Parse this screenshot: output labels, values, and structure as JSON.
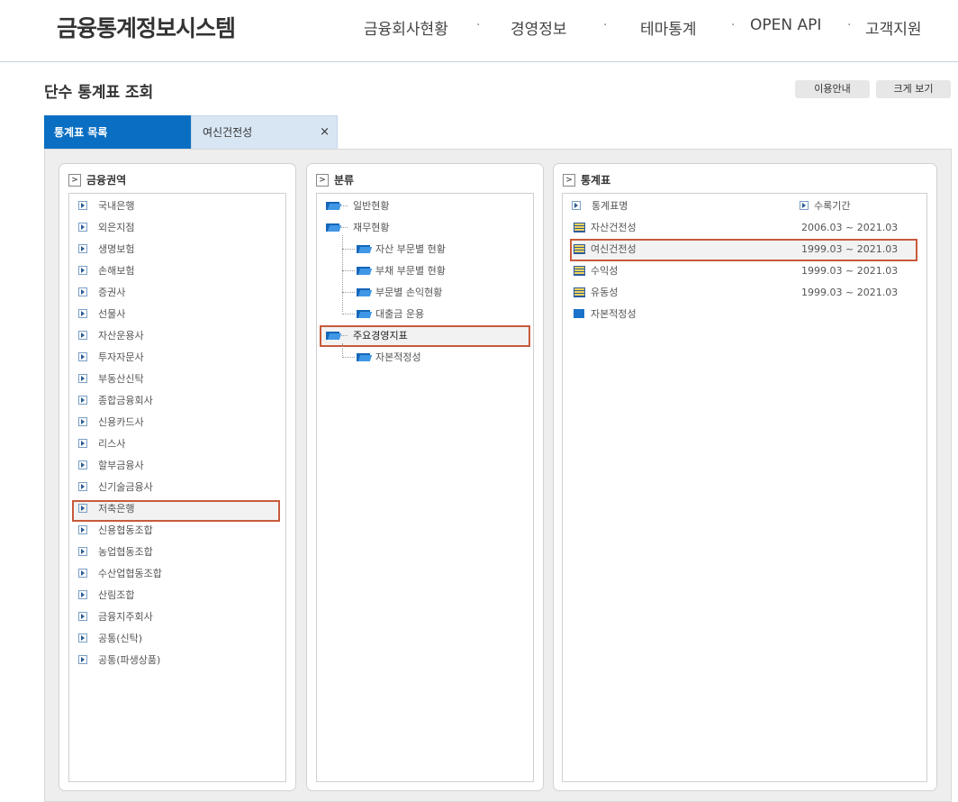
{
  "header": {
    "logo": "금융통계정보시스템",
    "nav": [
      "금융회사현황",
      "경영정보",
      "테마통계",
      "OPEN API",
      "고객지원"
    ],
    "separator": "·"
  },
  "page": {
    "title": "단수 통계표 조회",
    "buttons": {
      "guide": "이용안내",
      "zoom": "크게 보기"
    }
  },
  "tabs": {
    "active": "통계표 목록",
    "inactive": "여신건전성",
    "close": "×"
  },
  "panels": {
    "sector": {
      "head": "금융권역",
      "items": [
        "국내은행",
        "외은지점",
        "생명보험",
        "손해보험",
        "증권사",
        "선물사",
        "자산운용사",
        "투자자문사",
        "부동산신탁",
        "종합금융회사",
        "신용카드사",
        "리스사",
        "할부금융사",
        "신기술금융사",
        "저축은행",
        "신용협동조합",
        "농업협동조합",
        "수산업협동조합",
        "산림조합",
        "금융지주회사",
        "공통(신탁)",
        "공통(파생상품)"
      ],
      "selected": "저축은행"
    },
    "category": {
      "head": "분류",
      "items": [
        "일반현황",
        "재무현황",
        "자산 부문별 현황",
        "부채 부문별 현황",
        "부문별 손익현황",
        "대출금 운용",
        "주요경영지표",
        "자본적정성"
      ],
      "selected": "주요경영지표"
    },
    "table": {
      "head": "통계표",
      "col_name": "통계표명",
      "col_period": "수록기간",
      "rows": [
        {
          "name": "자산건전성",
          "period": "2006.03 ~ 2021.03"
        },
        {
          "name": "여신건전성",
          "period": "1999.03 ~ 2021.03"
        },
        {
          "name": "수익성",
          "period": "1999.03 ~ 2021.03"
        },
        {
          "name": "유동성",
          "period": "1999.03 ~ 2021.03"
        },
        {
          "name": "자본적정성",
          "period": ""
        }
      ],
      "selected": "여신건전성"
    },
    "arrow": ">"
  },
  "colors": {
    "accent": "#0a6fc2",
    "highlight_border": "#c85a3c",
    "folder": "#1666b8"
  }
}
